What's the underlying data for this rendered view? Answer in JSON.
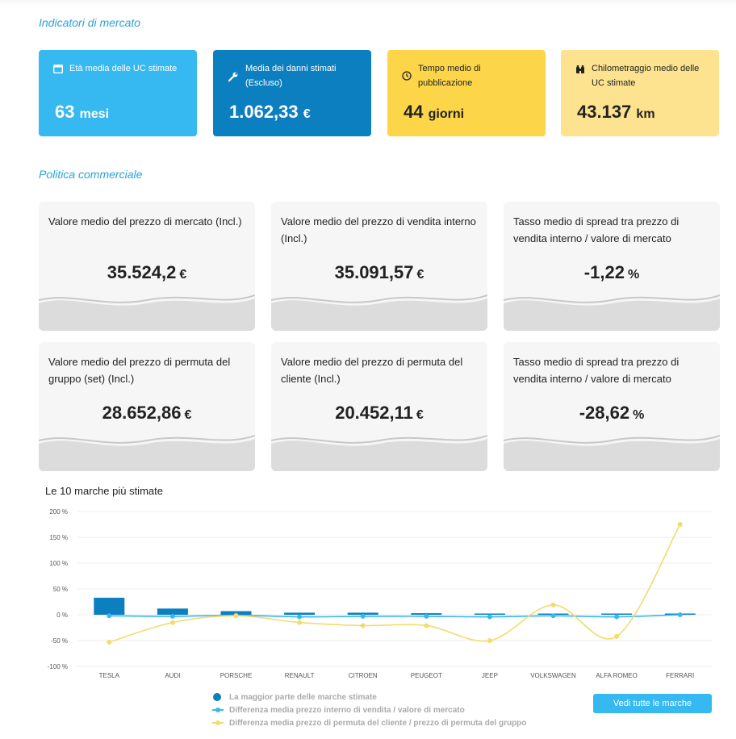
{
  "sections": {
    "market": "Indicatori di mercato",
    "commercial": "Politica commerciale"
  },
  "kpis": [
    {
      "label": "Età media delle UC stimate",
      "value": "63",
      "unit": "mesi",
      "icon": "calendar-icon"
    },
    {
      "label": "Media dei danni stimati (Escluso)",
      "value": "1.062,33",
      "unit": "€",
      "icon": "wrench-icon"
    },
    {
      "label": "Tempo medio di pubblicazione",
      "value": "44",
      "unit": "giorni",
      "icon": "clock-icon"
    },
    {
      "label": "Chilometraggio medio delle UC stimate",
      "value": "43.137",
      "unit": "km",
      "icon": "binoculars-icon"
    }
  ],
  "cards": [
    {
      "label": "Valore medio del prezzo di mercato (Incl.)",
      "value": "35.524,2",
      "unit": "€"
    },
    {
      "label": "Valore medio del prezzo di vendita interno (Incl.)",
      "value": "35.091,57",
      "unit": "€"
    },
    {
      "label": "Tasso medio di spread tra prezzo di vendita interno / valore di mercato",
      "value": "-1,22",
      "unit": "%"
    },
    {
      "label": "Valore medio del prezzo di permuta del gruppo (set) (Incl.)",
      "value": "28.652,86",
      "unit": "€"
    },
    {
      "label": "Valore medio del prezzo di permuta del cliente (Incl.)",
      "value": "20.452,11",
      "unit": "€"
    },
    {
      "label": "Tasso medio di spread tra prezzo di vendita interno / valore di mercato",
      "value": "-28,62",
      "unit": "%"
    }
  ],
  "chart_title": "Le 10 marche più stimate",
  "chart_data": {
    "type": "bar",
    "categories": [
      "TESLA",
      "AUDI",
      "PORSCHE",
      "RENAULT",
      "CITROEN",
      "PEUGEOT",
      "JEEP",
      "VOLKSWAGEN",
      "ALFA ROMEO",
      "FERRARI"
    ],
    "ylim": [
      -100,
      200
    ],
    "yticks": [
      "200 %",
      "150 %",
      "100 %",
      "50 %",
      "0 %",
      "-50 %",
      "-100 %"
    ],
    "ytick_values": [
      200,
      150,
      100,
      50,
      0,
      -50,
      -100
    ],
    "grid": true,
    "series": [
      {
        "name": "La maggior parte delle marche stimate",
        "kind": "bar",
        "color": "#0c7fc1",
        "values": [
          33,
          12,
          7,
          4,
          4,
          3,
          2,
          2,
          1,
          0
        ]
      },
      {
        "name": "Differenza media prezzo interno di vendita / valore di mercato",
        "kind": "line",
        "color": "#36b8f0",
        "values": [
          -2,
          -3,
          -1,
          -4,
          -3,
          -3,
          -4,
          -2,
          -4,
          0
        ]
      },
      {
        "name": "Differenza media prezzo di permuta del cliente / prezzo di permuta del gruppo",
        "kind": "line",
        "color": "#f2dc6a",
        "values": [
          -53,
          -15,
          -2,
          -15,
          -21,
          -21,
          -50,
          19,
          -42,
          175
        ]
      }
    ]
  },
  "button_label": "Vedi tutte le marche",
  "colors": {
    "accent": "#36b8f0",
    "dark_blue": "#0c7fc1",
    "yellow": "#fcd648",
    "light_yellow": "#fde38f"
  }
}
